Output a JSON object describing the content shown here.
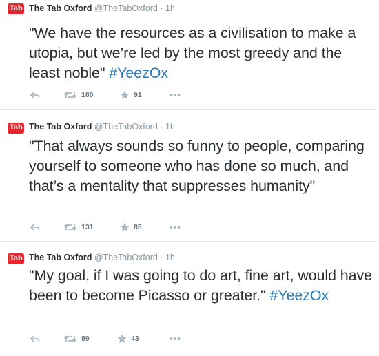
{
  "tweets": [
    {
      "author_name": "The Tab Oxford",
      "handle": "@TheTabOxford",
      "separator": "·",
      "time": "1h",
      "avatar_text": "Tab",
      "text": "\"We have the resources as a civilisation to make a utopia, but we’re led by the most greedy and the least noble\"",
      "hashtag": "#YeezOx",
      "retweets": "180",
      "favorites": "91"
    },
    {
      "author_name": "The Tab Oxford",
      "handle": "@TheTabOxford",
      "separator": "·",
      "time": "1h",
      "avatar_text": "Tab",
      "text": "\"That always sounds so funny to people, comparing yourself to someone who has done so much, and that’s a mentality that suppresses humanity\"",
      "hashtag": "",
      "retweets": "131",
      "favorites": "85"
    },
    {
      "author_name": "The Tab Oxford",
      "handle": "@TheTabOxford",
      "separator": "·",
      "time": "1h",
      "avatar_text": "Tab",
      "text": "\"My goal, if I was going to do art, fine art, would have been to become Picasso or greater.\"",
      "hashtag": "#YeezOx",
      "retweets": "89",
      "favorites": "43"
    }
  ],
  "colors": {
    "brand_red": "#e8262e",
    "link_blue": "#2b7bb9",
    "muted_gray": "#8899a6"
  },
  "icons": [
    "reply-icon",
    "retweet-icon",
    "star-icon",
    "more-icon"
  ]
}
